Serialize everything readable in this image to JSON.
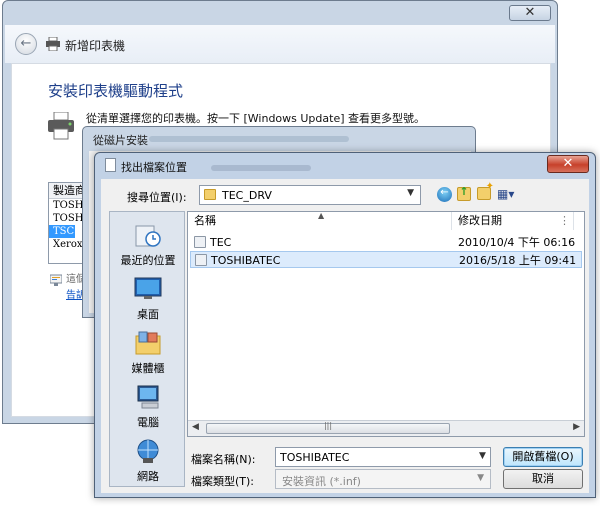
{
  "wizard": {
    "close_glyph": "✕",
    "back_glyph": "←",
    "window_title": "新增印表機",
    "heading": "安裝印表機驅動程式",
    "instruction": "從清單選擇您的印表機。按一下 [Windows Update] 查看更多型號。",
    "manufacturer_header": "製造商",
    "manufacturers": [
      "TOSHIB",
      "TOSHIB",
      "TSC",
      "Xerox"
    ],
    "selected_manufacturer_index": 2,
    "signed_note": "這個",
    "link_text": "告訴"
  },
  "install_disk": {
    "title": "從磁片安裝"
  },
  "browse": {
    "title": "找出檔案位置",
    "close_glyph": "✕",
    "look_in_label": "搜尋位置(I):",
    "look_in_value": "TEC_DRV",
    "toolbar": {
      "back_glyph": "←",
      "up_glyph": "↑",
      "new_glyph": "✦",
      "view_glyph": "▦▾"
    },
    "places": [
      {
        "label": "最近的位置",
        "icon": "recent-places-icon"
      },
      {
        "label": "桌面",
        "icon": "desktop-icon"
      },
      {
        "label": "媒體櫃",
        "icon": "libraries-icon"
      },
      {
        "label": "電腦",
        "icon": "computer-icon"
      },
      {
        "label": "網路",
        "icon": "network-icon"
      }
    ],
    "columns": {
      "name": "名稱",
      "date": "修改日期",
      "sort_glyph": "▲",
      "end_glyph": "⋮"
    },
    "files": [
      {
        "name": "TEC",
        "date": "2010/10/4 下午 06:16",
        "selected": false
      },
      {
        "name": "TOSHIBATEC",
        "date": "2016/5/18 上午 09:41",
        "selected": true
      }
    ],
    "scroll": {
      "left": "◀",
      "right": "▶",
      "grip": "|||"
    },
    "file_name_label": "檔案名稱(N):",
    "file_name_value": "TOSHIBATEC",
    "file_type_label": "檔案類型(T):",
    "file_type_value": "安裝資訊 (*.inf)",
    "open_button": "開啟舊檔(O)",
    "cancel_button": "取消",
    "dropdown_glyph": "▼"
  }
}
